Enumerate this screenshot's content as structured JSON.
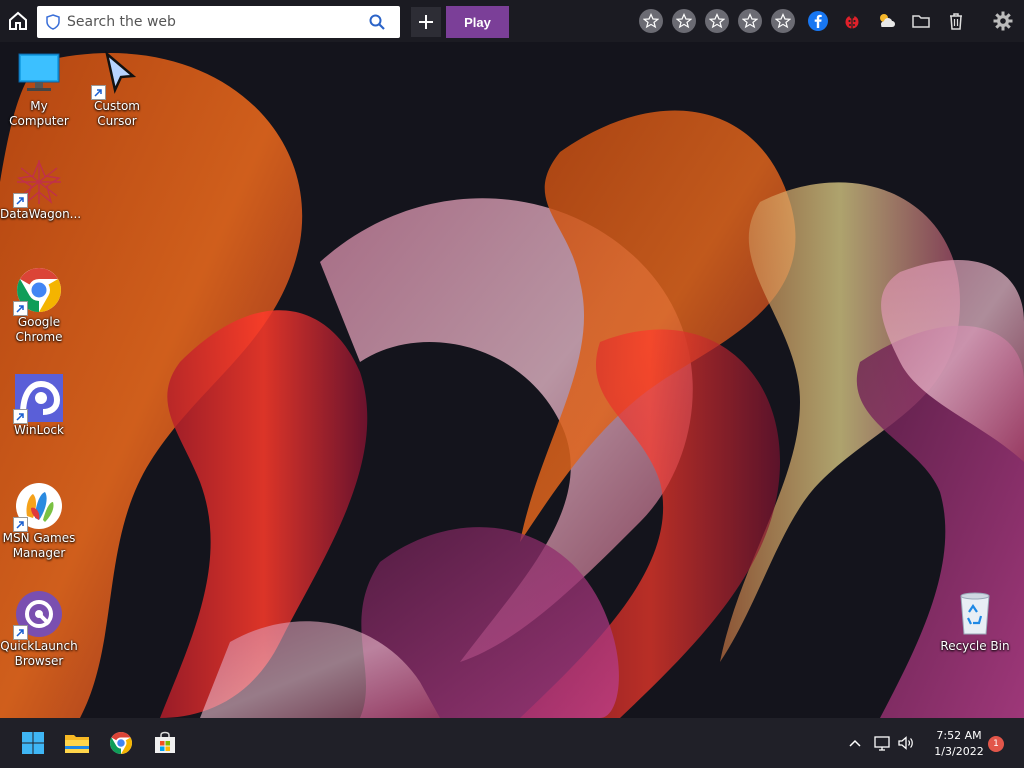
{
  "toolbar": {
    "search_placeholder": "Search the web",
    "play_label": "Play",
    "star_count": 5,
    "icons": [
      "home-icon",
      "search-icon",
      "plus-icon",
      "star-icon",
      "facebook-icon",
      "ladybug-icon",
      "weather-icon",
      "folder-icon",
      "trash-icon",
      "settings-icon"
    ]
  },
  "desktop": {
    "icons": [
      {
        "name": "my-computer",
        "label": "My Computer",
        "shortcut": false
      },
      {
        "name": "custom-cursor",
        "label": "Custom\nCursor",
        "shortcut": true
      },
      {
        "name": "datawagon",
        "label": "DataWagon...",
        "shortcut": true
      },
      {
        "name": "google-chrome",
        "label": "Google\nChrome",
        "shortcut": true
      },
      {
        "name": "winlock",
        "label": "WinLock",
        "shortcut": true
      },
      {
        "name": "msn-games-manager",
        "label": "MSN Games\nManager",
        "shortcut": true
      },
      {
        "name": "quicklaunch-browser",
        "label": "QuickLaunch\nBrowser",
        "shortcut": true
      },
      {
        "name": "recycle-bin",
        "label": "Recycle Bin",
        "shortcut": false
      }
    ]
  },
  "taskbar": {
    "apps": [
      "start-icon",
      "file-explorer-icon",
      "chrome-icon",
      "store-icon"
    ],
    "tray": [
      "chevron-up-icon",
      "network-icon",
      "volume-icon"
    ],
    "time": "7:52 AM",
    "date": "1/3/2022",
    "notification_count": "1"
  },
  "colors": {
    "toolbar_bg": "#1b1b22",
    "play_button": "#7b3f98",
    "taskbar_bg": "#202028",
    "notification_badge": "#e2564a"
  }
}
